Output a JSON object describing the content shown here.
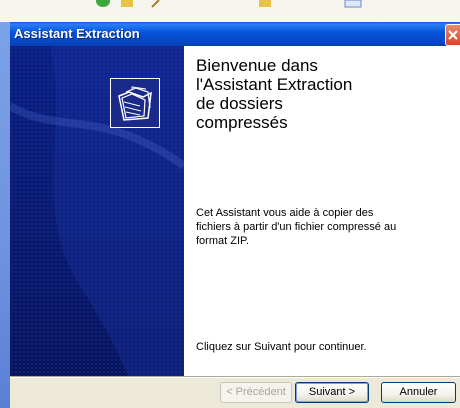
{
  "window": {
    "title": "Assistant Extraction"
  },
  "wizard": {
    "welcome_heading": "Bienvenue dans\nl'Assistant Extraction\nde dossiers\ncompressés",
    "description": "Cet Assistant vous aide à copier des\nfichiers à partir d'un fichier compressé au\nformat ZIP.",
    "continue_hint": "Cliquez sur Suivant pour continuer."
  },
  "buttons": {
    "back": "< Précédent",
    "next": "Suivant >",
    "cancel": "Annuler"
  },
  "colors": {
    "titlebar": "#0553d8",
    "banner": "#0a1a6e",
    "close": "#cf4a26"
  },
  "icons": {
    "wizard_icon": "compressed-folder-icon",
    "close_icon": "close-icon"
  }
}
